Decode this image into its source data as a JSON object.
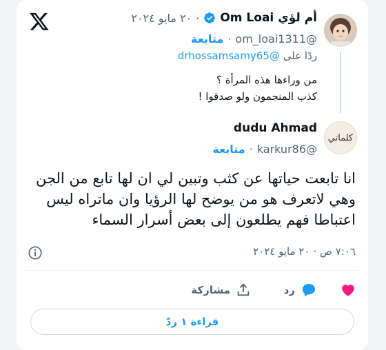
{
  "quoted": {
    "display_name": "أم لؤي Om Loai",
    "date": "٢٠ مايو ٢٠٢٤",
    "handle": "@om_loai1311",
    "follow_label": "متابعة",
    "reply_prefix": "ردًا على",
    "reply_mention": "@drhossamsamy65",
    "text_line1": "من وراءها هذه المرأة ؟",
    "text_line2": "كذب المنجمون ولو صدقوا !"
  },
  "tweet": {
    "display_name": "dudu Ahmad",
    "handle": "@karkur86",
    "follow_label": "متابعة",
    "avatar_text": "كلماتي",
    "text": "انا تابعت حياتها عن كثب وتبين لي ان لها تابع من الجن وهي لاتعرف هو من يوضح لها الرؤيا وان ماتراه ليس اعتباطا فهم يطلعون إلى بعض أسرار السماء",
    "timestamp": "٧:٠٦ ص · ٢٠ مايو ٢٠٢٤"
  },
  "actions": {
    "like_icon": "heart-icon",
    "reply_label": "رد",
    "share_label": "مشاركة"
  },
  "read_replies_label": "قراءة ١ ردّ",
  "colors": {
    "accent": "#1d9bf0",
    "like": "#f91880",
    "text": "#0f1419",
    "muted": "#536471"
  },
  "separator": "·"
}
